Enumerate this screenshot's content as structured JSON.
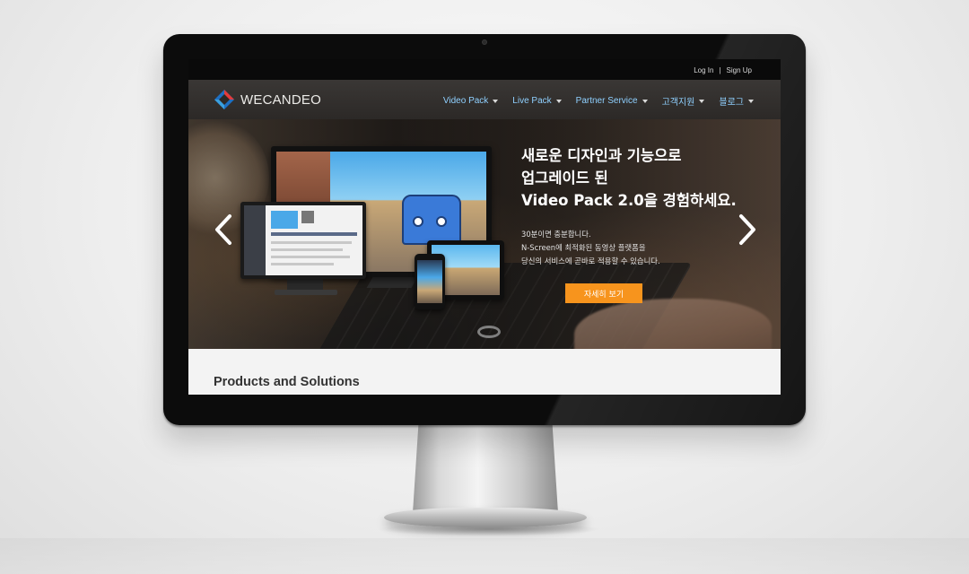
{
  "topbar": {
    "login": "Log In",
    "separator": "|",
    "signup": "Sign Up"
  },
  "brand": {
    "name": "WECANDEO"
  },
  "nav": {
    "items": [
      {
        "label": "Video Pack"
      },
      {
        "label": "Live Pack"
      },
      {
        "label": "Partner Service"
      },
      {
        "label": "고객지원"
      },
      {
        "label": "블로그"
      }
    ]
  },
  "hero": {
    "title_lines": [
      "새로운 디자인과 기능으로",
      "업그레이드 된",
      "Video Pack 2.0을 경험하세요."
    ],
    "desc_lines": [
      "30분이면 충분합니다.",
      "N-Screen에 최적화된 동영상 플랫폼을",
      "당신의 서비스에 곧바로 적용할 수 있습니다."
    ],
    "cta": "자세히 보기"
  },
  "products": {
    "title": "Products and Solutions"
  },
  "colors": {
    "accent": "#f7941d",
    "nav_link": "#8fd0ff",
    "navbar_bg": "#332f2d",
    "bezel": "#0c0c0c"
  },
  "icons": {
    "prev": "chevron-left-icon",
    "next": "chevron-right-icon",
    "caret": "caret-down-icon",
    "logo": "diamond-logo-icon"
  }
}
